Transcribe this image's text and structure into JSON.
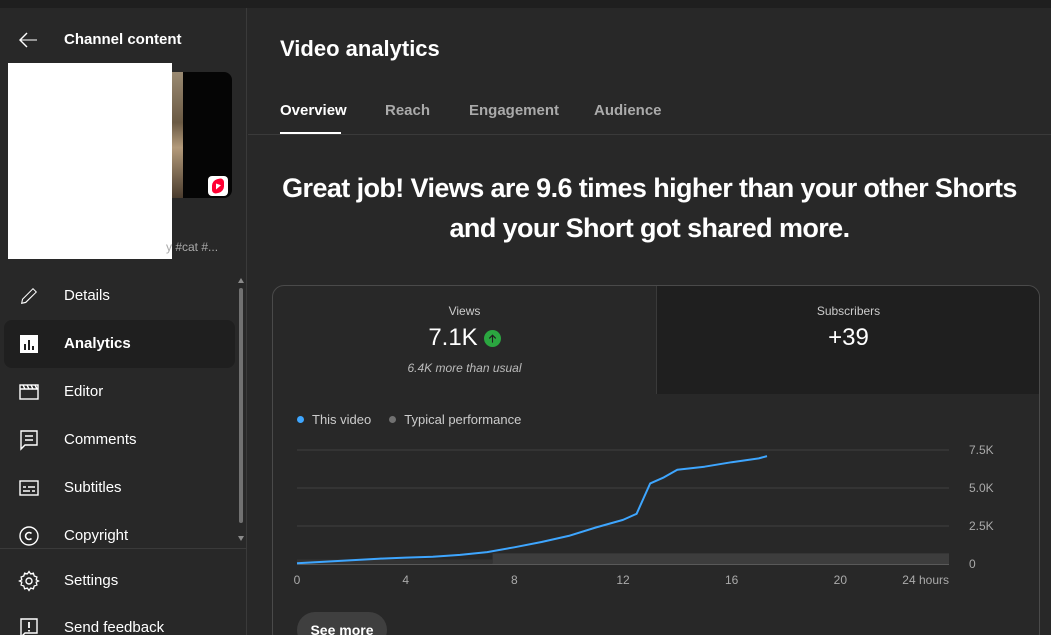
{
  "sidebar": {
    "back_title": "Channel content",
    "thumbnail_caption": "y #cat #...",
    "nav_items": [
      {
        "label": "Details",
        "icon": "pencil-icon"
      },
      {
        "label": "Analytics",
        "icon": "analytics-icon",
        "active": true
      },
      {
        "label": "Editor",
        "icon": "clapper-icon"
      },
      {
        "label": "Comments",
        "icon": "comment-icon"
      },
      {
        "label": "Subtitles",
        "icon": "subtitles-icon"
      },
      {
        "label": "Copyright",
        "icon": "copyright-icon"
      }
    ],
    "bottom_items": [
      {
        "label": "Settings",
        "icon": "gear-icon"
      },
      {
        "label": "Send feedback",
        "icon": "feedback-icon"
      }
    ]
  },
  "main": {
    "title": "Video analytics",
    "tabs": [
      {
        "label": "Overview",
        "active": true
      },
      {
        "label": "Reach"
      },
      {
        "label": "Engagement"
      },
      {
        "label": "Audience"
      }
    ],
    "headline_line1": "Great job! Views are 9.6 times higher than your other Shorts",
    "headline_line2": "and your Short got shared more.",
    "metrics": {
      "views": {
        "label": "Views",
        "value": "7.1K",
        "sub": "6.4K more than usual",
        "trend": "up"
      },
      "subscribers": {
        "label": "Subscribers",
        "value": "+39"
      }
    },
    "see_more_label": "See more"
  },
  "chart_data": {
    "type": "line",
    "series": [
      {
        "name": "This video",
        "color": "#3ea6ff",
        "x": [
          0,
          1,
          2,
          3,
          4,
          5,
          6,
          7,
          8,
          9,
          10,
          11,
          12,
          12.5,
          13,
          13.5,
          14,
          14.5,
          15,
          16,
          17,
          17.3
        ],
        "y": [
          50,
          150,
          250,
          350,
          420,
          480,
          600,
          780,
          1100,
          1450,
          1850,
          2400,
          2900,
          3300,
          5300,
          5700,
          6200,
          6300,
          6400,
          6700,
          6950,
          7100
        ]
      },
      {
        "name": "Typical performance",
        "color": "#717171",
        "type": "band"
      }
    ],
    "x_ticks": [
      "0",
      "4",
      "8",
      "12",
      "16",
      "20",
      "24 hours"
    ],
    "x_tick_values": [
      0,
      4,
      8,
      12,
      16,
      20,
      24
    ],
    "y_ticks": [
      "0",
      "2.5K",
      "5.0K",
      "7.5K"
    ],
    "y_tick_values": [
      0,
      2500,
      5000,
      7500
    ],
    "xlim": [
      0,
      24
    ],
    "ylim": [
      0,
      7500
    ],
    "band_upper": [
      700,
      700
    ],
    "grid": true,
    "legend_position": "top-left"
  },
  "colors": {
    "accent_line": "#3ea6ff",
    "up_badge": "#2ba640",
    "shorts_red": "#ff0033"
  }
}
